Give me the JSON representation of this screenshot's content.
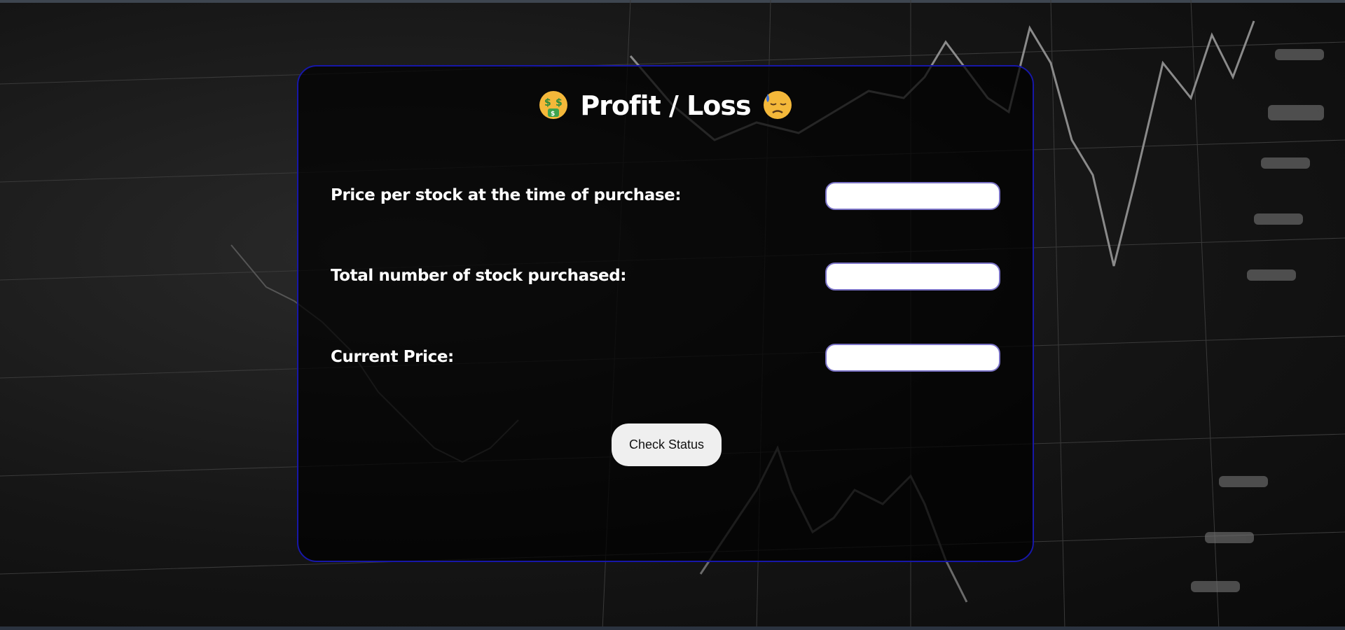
{
  "page": {
    "title": "Profit / Loss",
    "title_emoji_left": "money-mouth-face",
    "title_emoji_right": "downcast-face-with-sweat"
  },
  "form": {
    "purchase_price_label": "Price per stock at the time of purchase:",
    "purchase_price_value": "",
    "quantity_label": "Total number of stock purchased:",
    "quantity_value": "",
    "current_price_label": "Current Price:",
    "current_price_value": "",
    "submit_label": "Check Status"
  },
  "colors": {
    "card_border": "#1717a8",
    "input_border": "#7a72c6",
    "button_bg": "#efefef",
    "text": "#ffffff"
  }
}
